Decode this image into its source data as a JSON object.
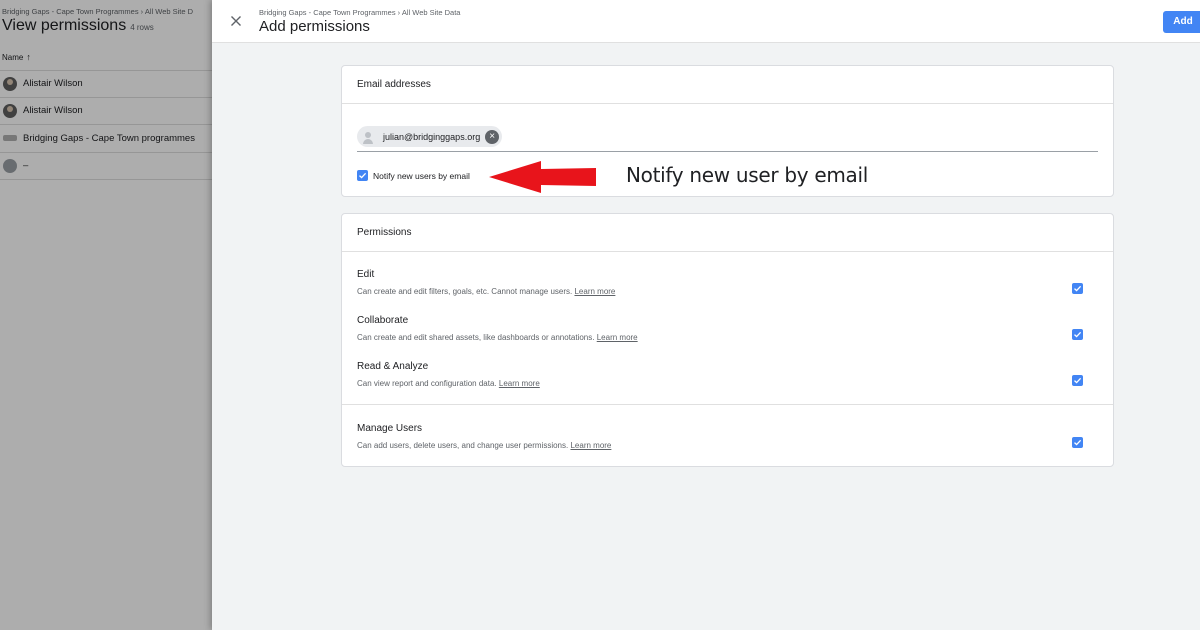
{
  "background": {
    "breadcrumb": "Bridging Gaps - Cape Town Programmes › All Web Site D",
    "title": "View permissions",
    "row_count": "4 rows",
    "column_header": "Name",
    "rows": [
      {
        "name": "Alistair Wilson",
        "avatar": "photo"
      },
      {
        "name": "Alistair Wilson",
        "avatar": "photo"
      },
      {
        "name": "Bridging Gaps - Cape Town programmes",
        "avatar": "logo"
      },
      {
        "name": "–",
        "avatar": "placeholder"
      }
    ]
  },
  "sheet": {
    "breadcrumb": "Bridging Gaps - Cape Town Programmes › All Web Site Data",
    "title": "Add permissions",
    "add_label": "Add",
    "close_icon": "close-icon",
    "accent_color": "#4285f4"
  },
  "email_card": {
    "header": "Email addresses",
    "chip": "julian@bridginggaps.org",
    "notify_label": "Notify new users by email",
    "notify_checked": true
  },
  "annotation": {
    "text": "Notify new user by email",
    "arrow_color": "#e8141b"
  },
  "permissions_card": {
    "header": "Permissions",
    "items": [
      {
        "title": "Edit",
        "desc": "Can create and edit filters, goals, etc. Cannot manage users.",
        "link": "Learn more",
        "checked": true
      },
      {
        "title": "Collaborate",
        "desc": "Can create and edit shared assets, like dashboards or annotations.",
        "link": "Learn more",
        "checked": true
      },
      {
        "title": "Read & Analyze",
        "desc": "Can view report and configuration data.",
        "link": "Learn more",
        "checked": true
      },
      {
        "title": "Manage Users",
        "desc": "Can add users, delete users, and change user permissions.",
        "link": "Learn more",
        "checked": true
      }
    ]
  }
}
